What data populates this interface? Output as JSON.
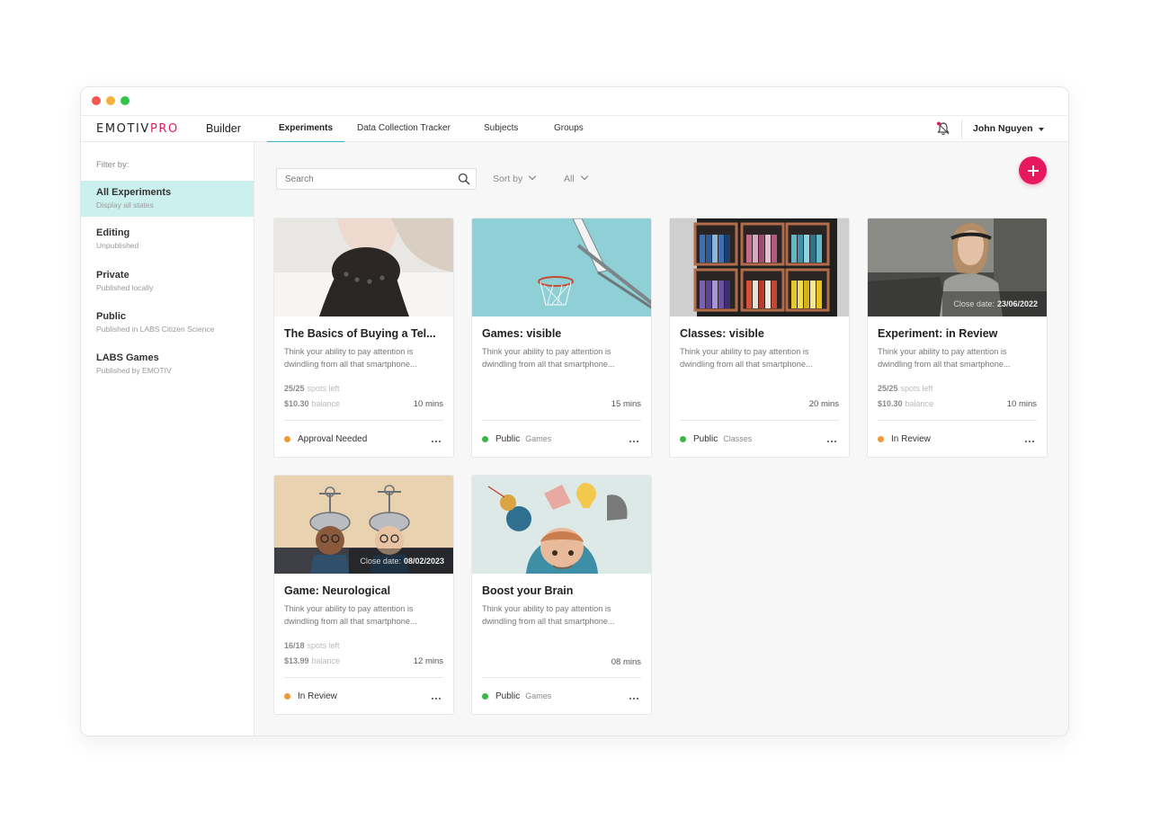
{
  "app": {
    "logo_main": "EMOTIV",
    "logo_accent": "PRO",
    "module": "Builder"
  },
  "tabs": [
    {
      "label": "Experiments",
      "active": true
    },
    {
      "label": "Data Collection Tracker",
      "active": false
    },
    {
      "label": "Subjects",
      "active": false
    },
    {
      "label": "Groups",
      "active": false
    }
  ],
  "user": {
    "name": "John Nguyen"
  },
  "sidebar": {
    "filter_label": "Filter by:",
    "items": [
      {
        "title": "All Experiments",
        "subtitle": "Display all states",
        "active": true
      },
      {
        "title": "Editing",
        "subtitle": "Unpublished",
        "active": false
      },
      {
        "title": "Private",
        "subtitle": "Published locally",
        "active": false
      },
      {
        "title": "Public",
        "subtitle": "Published in LABS Citizen Science",
        "active": false
      },
      {
        "title": "LABS Games",
        "subtitle": "Published by EMOTIV",
        "active": false
      }
    ]
  },
  "toolbar": {
    "search_placeholder": "Search",
    "sort_label": "Sort by",
    "filter_label": "All"
  },
  "colors": {
    "accent": "#e7195e",
    "tab_underline": "#39b5c4",
    "active_filter_bg": "#ccf0ee",
    "status_orange": "#f0993a",
    "status_green": "#3db54a"
  },
  "cards": [
    {
      "title": "The Basics of Buying a Tel...",
      "desc": "Think your ability to pay attention is dwindling from all that smartphone...",
      "spots": "25/25",
      "spots_label": "spots left",
      "balance": "$10.30",
      "balance_label": "balance",
      "mins": "10 mins",
      "status": "Approval Needed",
      "status_sub": "",
      "status_color": "orange",
      "close_label": "",
      "close_date": ""
    },
    {
      "title": "Games: visible",
      "desc": "Think your ability to pay attention is dwindling from all that smartphone...",
      "spots": "",
      "spots_label": "",
      "balance": "",
      "balance_label": "",
      "mins": "15 mins",
      "status": "Public",
      "status_sub": "Games",
      "status_color": "green",
      "close_label": "",
      "close_date": ""
    },
    {
      "title": "Classes: visible",
      "desc": "Think your ability to pay attention is dwindling from all that smartphone...",
      "spots": "",
      "spots_label": "",
      "balance": "",
      "balance_label": "",
      "mins": "20 mins",
      "status": "Public",
      "status_sub": "Classes",
      "status_color": "green",
      "close_label": "",
      "close_date": ""
    },
    {
      "title": "Experiment: in Review",
      "desc": "Think your ability to pay attention is dwindling from all that smartphone...",
      "spots": "25/25",
      "spots_label": "spots left",
      "balance": "$10.30",
      "balance_label": "balance",
      "mins": "10 mins",
      "status": "In Review",
      "status_sub": "",
      "status_color": "orange",
      "close_label": "Close date:",
      "close_date": "23/06/2022"
    },
    {
      "title": "Game: Neurological",
      "desc": "Think your ability to pay attention is dwindling from all that smartphone...",
      "spots": "16/18",
      "spots_label": "spots left",
      "balance": "$13.99",
      "balance_label": "balance",
      "mins": "12 mins",
      "status": "In Review",
      "status_sub": "",
      "status_color": "orange",
      "close_label": "Close date:",
      "close_date": "08/02/2023"
    },
    {
      "title": "Boost your Brain",
      "desc": "Think your ability to pay attention is dwindling from all that smartphone...",
      "spots": "",
      "spots_label": "",
      "balance": "",
      "balance_label": "",
      "mins": "08 mins",
      "status": "Public",
      "status_sub": "Games",
      "status_color": "green",
      "close_label": "",
      "close_date": ""
    }
  ]
}
